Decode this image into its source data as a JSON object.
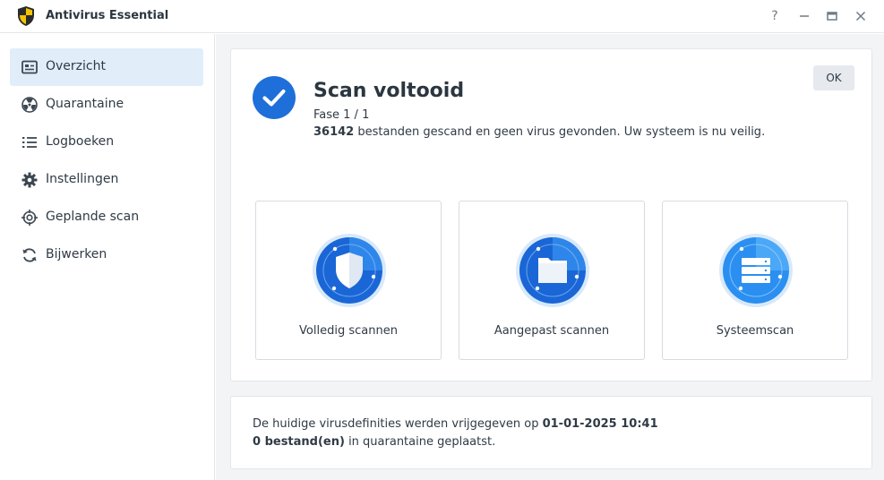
{
  "app": {
    "title": "Antivirus Essential"
  },
  "window_controls": {
    "help": "?",
    "minimize": "—",
    "maximize": "▭",
    "close": "✕"
  },
  "sidebar": {
    "items": [
      {
        "label": "Overzicht",
        "icon": "overview-icon",
        "active": true
      },
      {
        "label": "Quarantaine",
        "icon": "radiation-icon",
        "active": false
      },
      {
        "label": "Logboeken",
        "icon": "list-icon",
        "active": false
      },
      {
        "label": "Instellingen",
        "icon": "gear-icon",
        "active": false
      },
      {
        "label": "Geplande scan",
        "icon": "target-icon",
        "active": false
      },
      {
        "label": "Bijwerken",
        "icon": "refresh-icon",
        "active": false
      }
    ]
  },
  "status": {
    "title": "Scan voltooid",
    "phase": "Fase 1 / 1",
    "files_count": "36142",
    "summary_text": " bestanden gescand en geen virus gevonden. Uw systeem is nu veilig.",
    "ok_label": "OK"
  },
  "scan_options": [
    {
      "label": "Volledig scannen",
      "icon": "shield-icon"
    },
    {
      "label": "Aangepast scannen",
      "icon": "folder-icon"
    },
    {
      "label": "Systeemscan",
      "icon": "server-icon"
    }
  ],
  "info": {
    "definitions_prefix": "De huidige virusdefinities werden vrijgegeven op ",
    "definitions_date": "01-01-2025 10:41",
    "quarantine_count": "0 bestand(en)",
    "quarantine_suffix": " in quarantaine geplaatst."
  },
  "colors": {
    "accent": "#1e6fd9",
    "active_nav_bg": "#e1edf9",
    "main_bg": "#f2f4f6"
  }
}
